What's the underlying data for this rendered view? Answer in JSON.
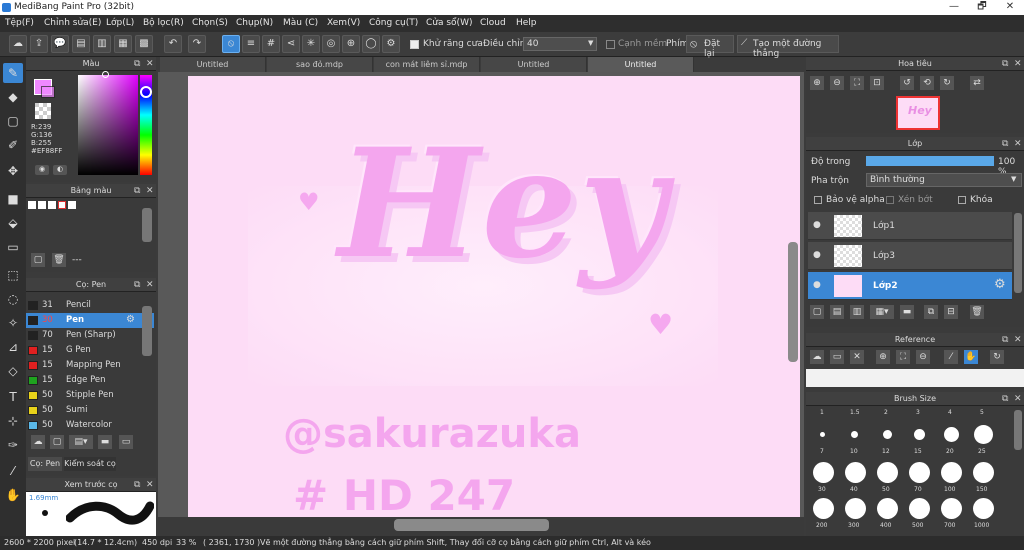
{
  "window": {
    "title": "MediBang Paint Pro (32bit)",
    "min": "—",
    "max": "🗗",
    "close": "✕"
  },
  "menu": [
    "Tệp(F)",
    "Chỉnh sửa(E)",
    "Lớp(L)",
    "Bộ lọc(R)",
    "Chọn(S)",
    "Chụp(N)",
    "Màu (C)",
    "Xem(V)",
    "Công cụ(T)",
    "Cửa sổ(W)",
    "Cloud",
    "Help"
  ],
  "toolbar": {
    "antialias_label": "Khử răng cưa",
    "adjust_label": "Điều chỉnh",
    "adjust_value": "40",
    "edge_label": "Cạnh mềm",
    "pen_label": "Phím",
    "reset_label": "Đặt lại",
    "create_line_label": "Tạo một đường thẳng"
  },
  "tabs": [
    "Untitled",
    "sao đỏ.mdp",
    "con mát liêm sỉ.mdp",
    "Untitled",
    "Untitled"
  ],
  "color_panel": {
    "title": "Màu",
    "r": "R:239",
    "g": "G:136",
    "b": "B:255",
    "hex": "#EF88FF",
    "primary": "#ef88ff"
  },
  "palette_panel": {
    "title": "Bảng màu",
    "dash": "---"
  },
  "brush_panel": {
    "title": "Cọ: Pen",
    "tab1": "Cọ: Pen",
    "tab2": "Kiểm soát cọ",
    "items": [
      {
        "num": "31",
        "name": "Pencil",
        "color": "#222222"
      },
      {
        "num": "30",
        "name": "Pen",
        "color": "#222222"
      },
      {
        "num": "70",
        "name": "Pen (Sharp)",
        "color": "#222222"
      },
      {
        "num": "15",
        "name": "G Pen",
        "color": "#e02020"
      },
      {
        "num": "15",
        "name": "Mapping Pen",
        "color": "#e02020"
      },
      {
        "num": "15",
        "name": "Edge Pen",
        "color": "#1fa31f"
      },
      {
        "num": "50",
        "name": "Stipple Pen",
        "color": "#e8d21a"
      },
      {
        "num": "50",
        "name": "Sumi",
        "color": "#e8d21a"
      },
      {
        "num": "50",
        "name": "Watercolor",
        "color": "#5ab8e8"
      }
    ]
  },
  "preview_panel": {
    "title": "Xem trước cọ",
    "size": "1.69mm"
  },
  "nav_panel": {
    "title": "Hoa tiêu"
  },
  "layer_panel": {
    "title": "Lớp",
    "opacity_label": "Độ trong",
    "opacity_value": "100 %",
    "opacity_fraction": 1.0,
    "blend_label": "Pha trộn",
    "blend_value": "Bình thường",
    "protect_alpha": "Bảo vệ alpha",
    "clipping": "Xén bớt",
    "lock": "Khóa",
    "layers": [
      "Lớp1",
      "Lớp3",
      "Lớp2"
    ]
  },
  "reference_panel": {
    "title": "Reference"
  },
  "brush_size_panel": {
    "title": "Brush Size",
    "row1": [
      "1",
      "1.5",
      "2",
      "3",
      "4",
      "5"
    ],
    "row2": [
      "7",
      "10",
      "12",
      "15",
      "20",
      "25"
    ],
    "row3": [
      "30",
      "40",
      "50",
      "70",
      "100",
      "150"
    ],
    "row4": [
      "200",
      "300",
      "400",
      "500",
      "700",
      "1000"
    ]
  },
  "artwork": {
    "word": "Hey",
    "handle": "@sakurazuka",
    "tag": "# HD 247"
  },
  "status": {
    "dimensions": "2600 * 2200 pixel",
    "physical": "(14.7 * 12.4cm)",
    "dpi": "450 dpi",
    "zoom": "33 %",
    "coords": "( 2361, 1730 )",
    "hint": "Vẽ một đường thẳng bằng cách giữ phím Shift, Thay đổi cỡ cọ bằng cách giữ phím Ctrl, Alt và kéo"
  }
}
